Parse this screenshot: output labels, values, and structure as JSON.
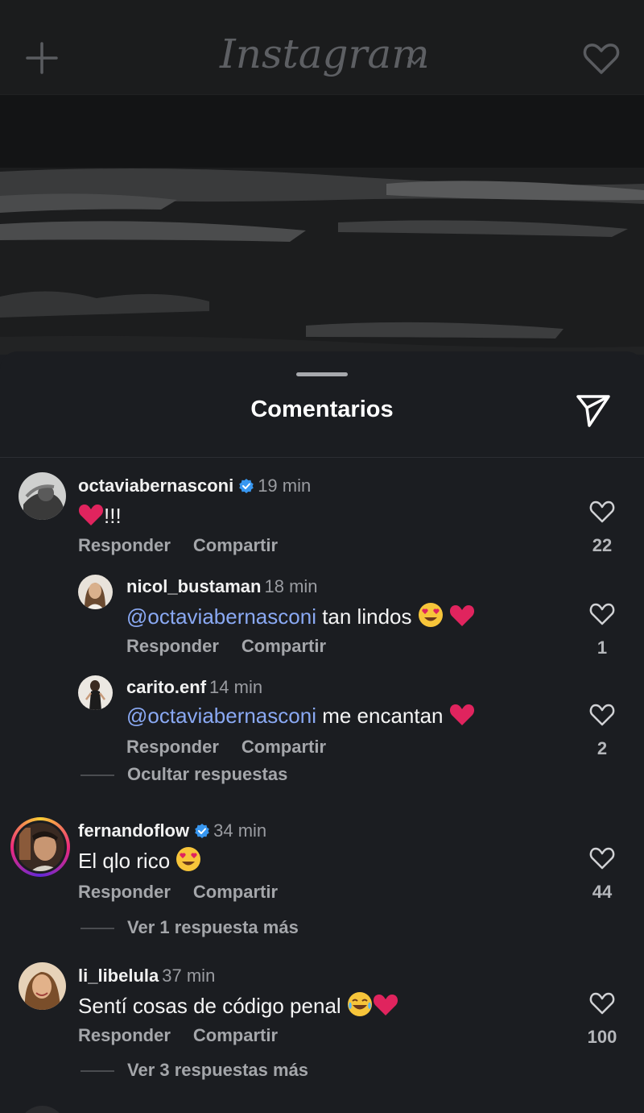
{
  "app": {
    "logo_text": "Instagram",
    "icons": {
      "new_post": "plus-icon",
      "account_switch": "chevron-down-icon",
      "activity": "heart-icon"
    }
  },
  "sheet": {
    "title": "Comentarios",
    "share_icon": "send-icon"
  },
  "comments": [
    {
      "username": "octaviabernasconi",
      "verified": true,
      "time": "19 min",
      "text": "!!!",
      "likes": "22",
      "reply_label": "Responder",
      "share_label": "Compartir",
      "replies": [
        {
          "username": "nicol_bustaman",
          "time": "18 min",
          "mention": "@octaviabernasconi",
          "text": " tan lindos ",
          "likes": "1",
          "reply_label": "Responder",
          "share_label": "Compartir"
        },
        {
          "username": "carito.enf",
          "time": "14 min",
          "mention": "@octaviabernasconi",
          "text": " me encantan ",
          "likes": "2",
          "reply_label": "Responder",
          "share_label": "Compartir"
        }
      ],
      "replies_toggle": "Ocultar respuestas"
    },
    {
      "username": "fernandoflow",
      "verified": true,
      "time": "34 min",
      "text": "El qlo rico ",
      "likes": "44",
      "reply_label": "Responder",
      "share_label": "Compartir",
      "replies_toggle": "Ver 1 respuesta más"
    },
    {
      "username": "li_libelula",
      "verified": false,
      "time": "37 min",
      "text": "Sentí cosas de código penal ",
      "likes": "100",
      "reply_label": "Responder",
      "share_label": "Compartir",
      "replies_toggle": "Ver 3 respuestas más"
    }
  ],
  "colors": {
    "background": "#1b1d21",
    "mention": "#8aa9f3",
    "verified": "#3897f0",
    "heart": "#e0245e"
  }
}
